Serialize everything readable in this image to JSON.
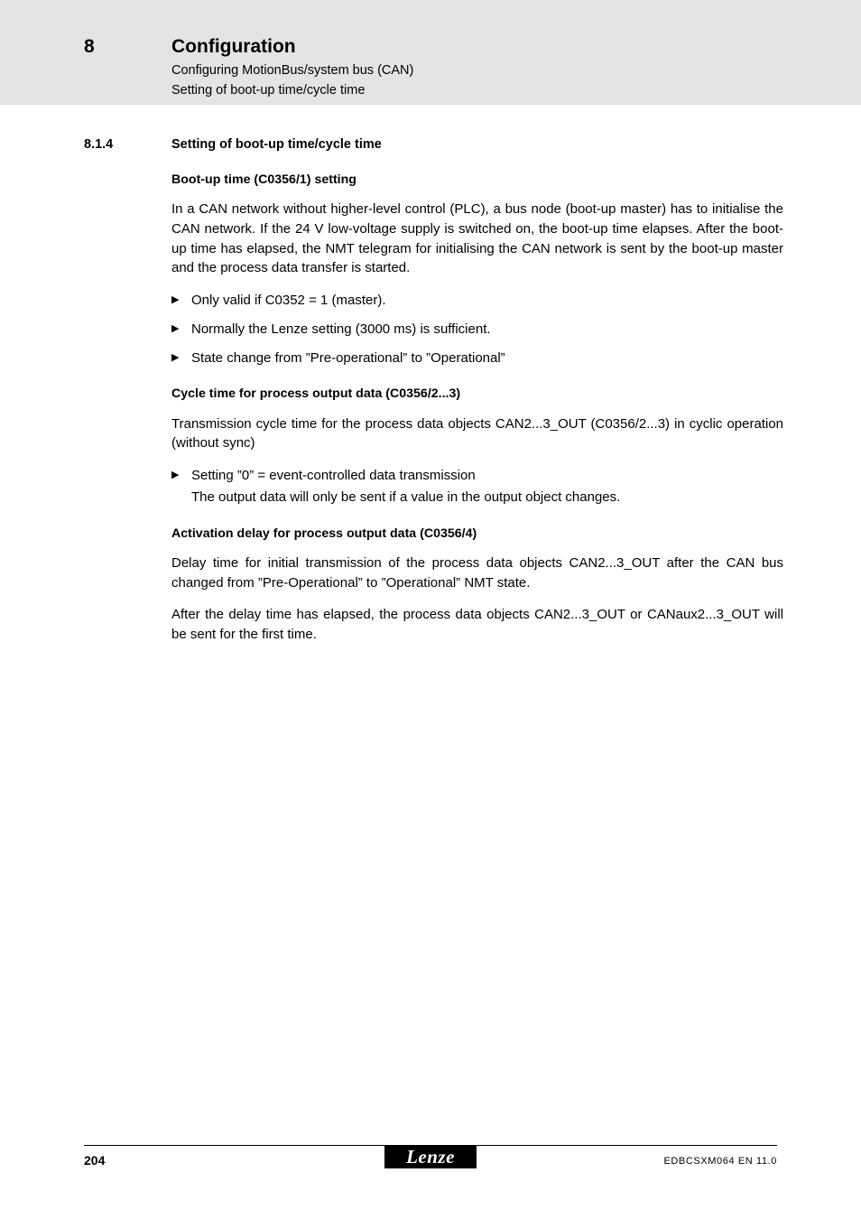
{
  "header": {
    "chapter_number": "8",
    "title": "Configuration",
    "subtitle_1": "Configuring MotionBus/system bus (CAN)",
    "subtitle_2": "Setting of boot-up time/cycle time"
  },
  "section": {
    "number": "8.1.4",
    "title": "Setting of boot-up time/cycle time"
  },
  "blocks": {
    "bootup": {
      "heading": "Boot-up time (C0356/1) setting",
      "paragraph": "In a CAN network without higher-level control (PLC), a bus node (boot-up master) has to initialise the CAN network. If the 24 V low-voltage supply is switched on, the boot-up time elapses. After the boot-up time has elapsed, the NMT telegram for initialising the CAN network is sent by the boot-up master and the process data transfer is started.",
      "bullets": [
        "Only valid if C0352 = 1 (master).",
        "Normally the Lenze setting (3000 ms) is sufficient.",
        "State change from ”Pre-operational” to ”Operational”"
      ]
    },
    "cycle_time": {
      "heading": "Cycle time for process output data (C0356/2...3)",
      "paragraph": "Transmission cycle time for the process data objects CAN2...3_OUT (C0356/2...3) in cyclic operation (without sync)",
      "bullet": "Setting ”0” = event-controlled data transmission",
      "bullet_sub": "The output data will only be sent if a value in the output object changes."
    },
    "activation_delay": {
      "heading": "Activation delay for process output data (C0356/4)",
      "paragraph_1": "Delay time for initial transmission of the process data objects CAN2...3_OUT after the CAN bus changed from ”Pre-Operational” to ”Operational” NMT state.",
      "paragraph_2": "After the delay time has elapsed, the process data objects CAN2...3_OUT or CANaux2...3_OUT will be sent for the first time."
    }
  },
  "footer": {
    "page_number": "204",
    "logo_text": "Lenze",
    "document_code": "EDBCSXM064 EN 11.0"
  },
  "icons": {
    "bullet_glyph": "▶"
  }
}
